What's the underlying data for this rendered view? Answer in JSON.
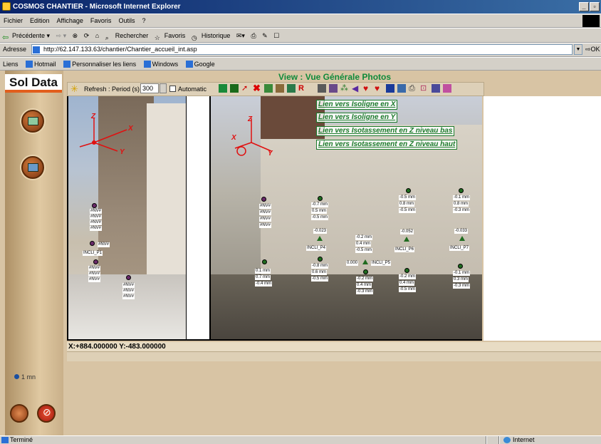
{
  "window": {
    "title": "COSMOS CHANTIER - Microsoft Internet Explorer"
  },
  "menu": [
    "Fichier",
    "Edition",
    "Affichage",
    "Favoris",
    "Outils",
    "?"
  ],
  "nav": {
    "back": "Précédente",
    "search": "Rechercher",
    "favorites": "Favoris",
    "history": "Historique"
  },
  "address": {
    "label": "Adresse",
    "url": "http://62.147.133.63/chantier/Chantier_accueil_int.asp",
    "go": "OK"
  },
  "links": {
    "label": "Liens",
    "items": [
      "Hotmail",
      "Personnaliser les liens",
      "Windows",
      "Google"
    ]
  },
  "sidebar": {
    "logo": "Sol Data",
    "timer": "1 mn"
  },
  "view": {
    "title": "View : Vue Générale Photos"
  },
  "toolbar": {
    "refresh_label": "Refresh : Period (s)",
    "period_value": "300",
    "automatic_label": "Automatic"
  },
  "photo_links": [
    "Lien vers Isoligne en X",
    "Lien vers Isoligne en Y",
    "Lien vers Isotassement en Z niveau bas",
    "Lien vers Isotassement en Z niveau haut"
  ],
  "axes_left": {
    "x": "X",
    "y": "Y",
    "z": "Z"
  },
  "axes_right": {
    "x": "X",
    "y": "Y",
    "z": "Z"
  },
  "labels": {
    "nv": "#NV#",
    "incli1": "INCLI_P1",
    "incli4": "INCLI_P4",
    "incli5": "INCLI_P5",
    "incli6": "INCLI_P6",
    "incli7": "INCLI_P7",
    "a": [
      "-0.7 mm",
      "0.5 mm",
      "-0.5 mm"
    ],
    "b": [
      "-0.5 mm",
      "0.8 mm",
      "-0.5 mm"
    ],
    "c": [
      "-0.1 mm",
      "0.8 mm",
      "-0.3 mm"
    ],
    "d": [
      "-0.2 mm",
      "0.4 mm",
      "-0.5 mm"
    ],
    "e": [
      "-0.2 mm",
      "0.4 mm",
      "-0.5 mm"
    ],
    "f": [
      "-0.1 mm",
      "0.3 mm",
      "-0.3 mm"
    ],
    "g": [
      "-0.8 mm",
      "0.6 mm",
      "-0.5 mm"
    ],
    "h": [
      "-0.2 mm",
      "0.4 mm",
      "-0.3 mm"
    ],
    "i": [
      "0.1 mm",
      "0.7 mm",
      "-0.4 mm"
    ],
    "v023": "-0.023",
    "v052": "-0.052",
    "v033": "-0.033",
    "v000": "0.000"
  },
  "coords": "X:+884.000000 Y:-483.000000",
  "status": {
    "text": "Terminé",
    "zone": "Internet"
  }
}
